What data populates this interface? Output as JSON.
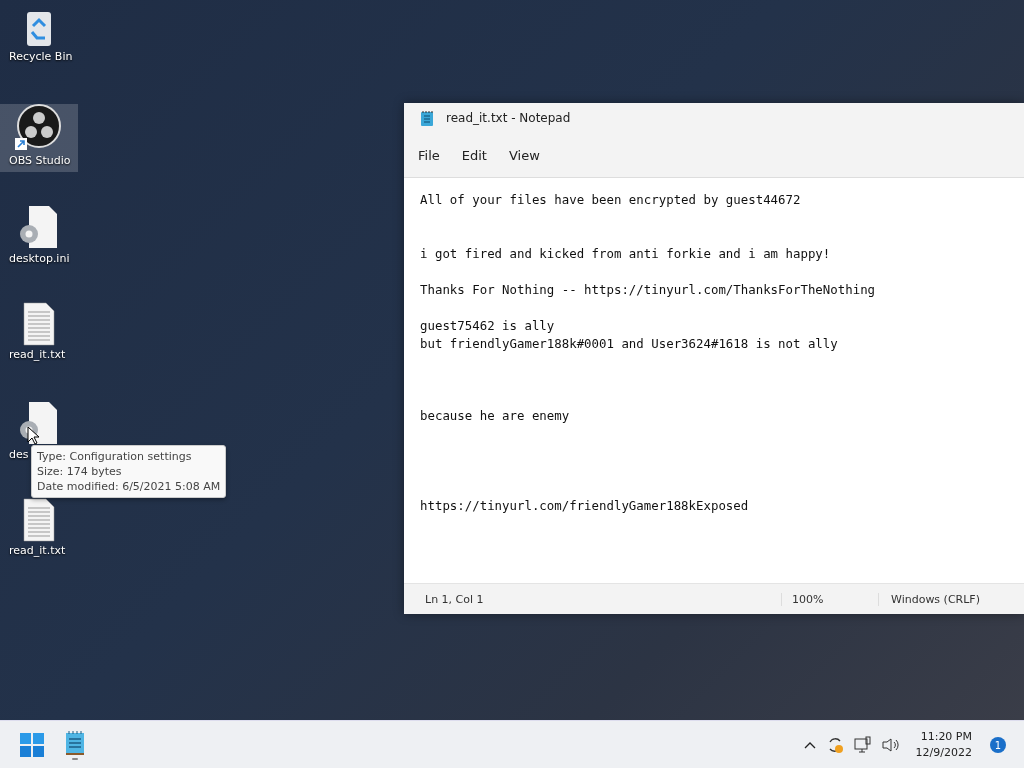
{
  "desktop_icons": [
    {
      "label": "Recycle Bin",
      "kind": "recycle",
      "selected": false
    },
    {
      "label": "OBS Studio",
      "kind": "obs",
      "selected": true
    },
    {
      "label": "desktop.ini",
      "kind": "ini",
      "selected": false
    },
    {
      "label": "read_it.txt",
      "kind": "txt",
      "selected": false
    },
    {
      "label": "des",
      "kind": "ini",
      "selected": false
    },
    {
      "label": "read_it.txt",
      "kind": "txt",
      "selected": false
    }
  ],
  "tooltip": [
    "Type: Configuration settings",
    "Size: 174 bytes",
    "Date modified: 6/5/2021 5:08 AM"
  ],
  "notepad": {
    "title": "read_it.txt - Notepad",
    "menu": [
      "File",
      "Edit",
      "View"
    ],
    "content": "All of your files have been encrypted by guest44672\n\n\ni got fired and kicked from anti forkie and i am happy!\n\nThanks For Nothing -- https://tinyurl.com/ThanksForTheNothing\n\nguest75462 is ally\nbut friendlyGamer188k#0001 and User3624#1618 is not ally\n\n\n\nbecause he are enemy\n\n\n\n\nhttps://tinyurl.com/friendlyGamer188kExposed",
    "status_bar": [
      "Ln 1, Col 1",
      "100%",
      "Windows (CRLF)"
    ]
  },
  "taskbar": {
    "time": "11:20 PM",
    "date": "12/9/2022",
    "notifications": "1"
  }
}
